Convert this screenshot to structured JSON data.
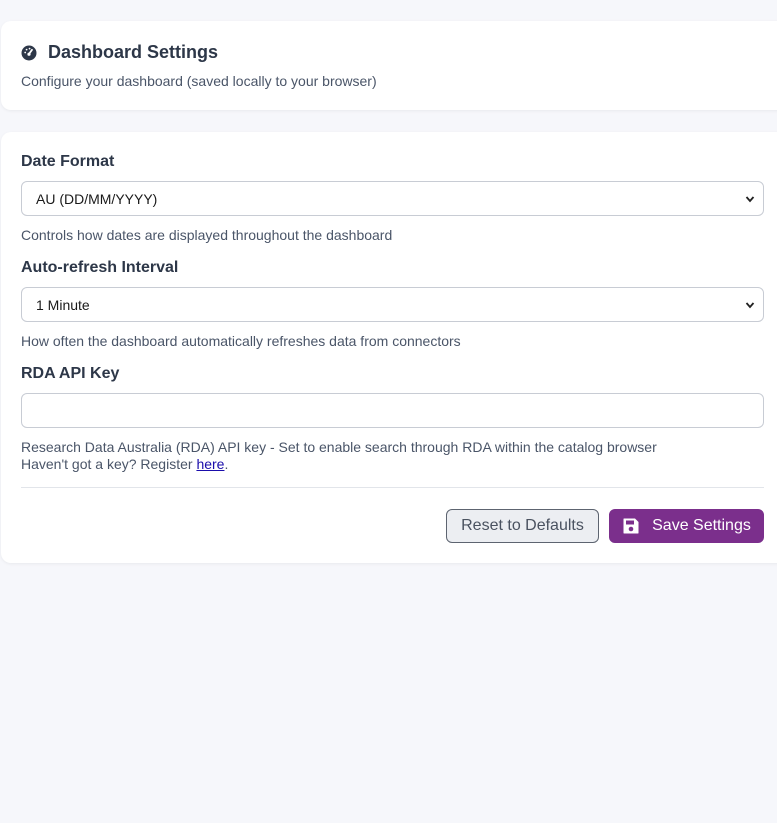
{
  "header": {
    "title": "Dashboard Settings",
    "subtitle": "Configure your dashboard (saved locally to your browser)",
    "icon": "gauge-icon"
  },
  "date_format": {
    "label": "Date Format",
    "selected": "AU (DD/MM/YYYY)",
    "help": "Controls how dates are displayed throughout the dashboard"
  },
  "refresh_interval": {
    "label": "Auto-refresh Interval",
    "selected": "1 Minute",
    "help": "How often the dashboard automatically refreshes data from connectors"
  },
  "rda_key": {
    "label": "RDA API Key",
    "value": "",
    "placeholder": "",
    "help": "Research Data Australia (RDA) API key - Set to enable search through RDA within the catalog browser",
    "register_prefix": "Haven't got a key? Register ",
    "register_link": "here",
    "register_suffix": "."
  },
  "buttons": {
    "reset_label": "Reset to Defaults",
    "save_label": "Save Settings",
    "save_icon": "floppy-disk-icon"
  },
  "colors": {
    "accent": "#7b2f8c",
    "background": "#f6f7fb"
  }
}
